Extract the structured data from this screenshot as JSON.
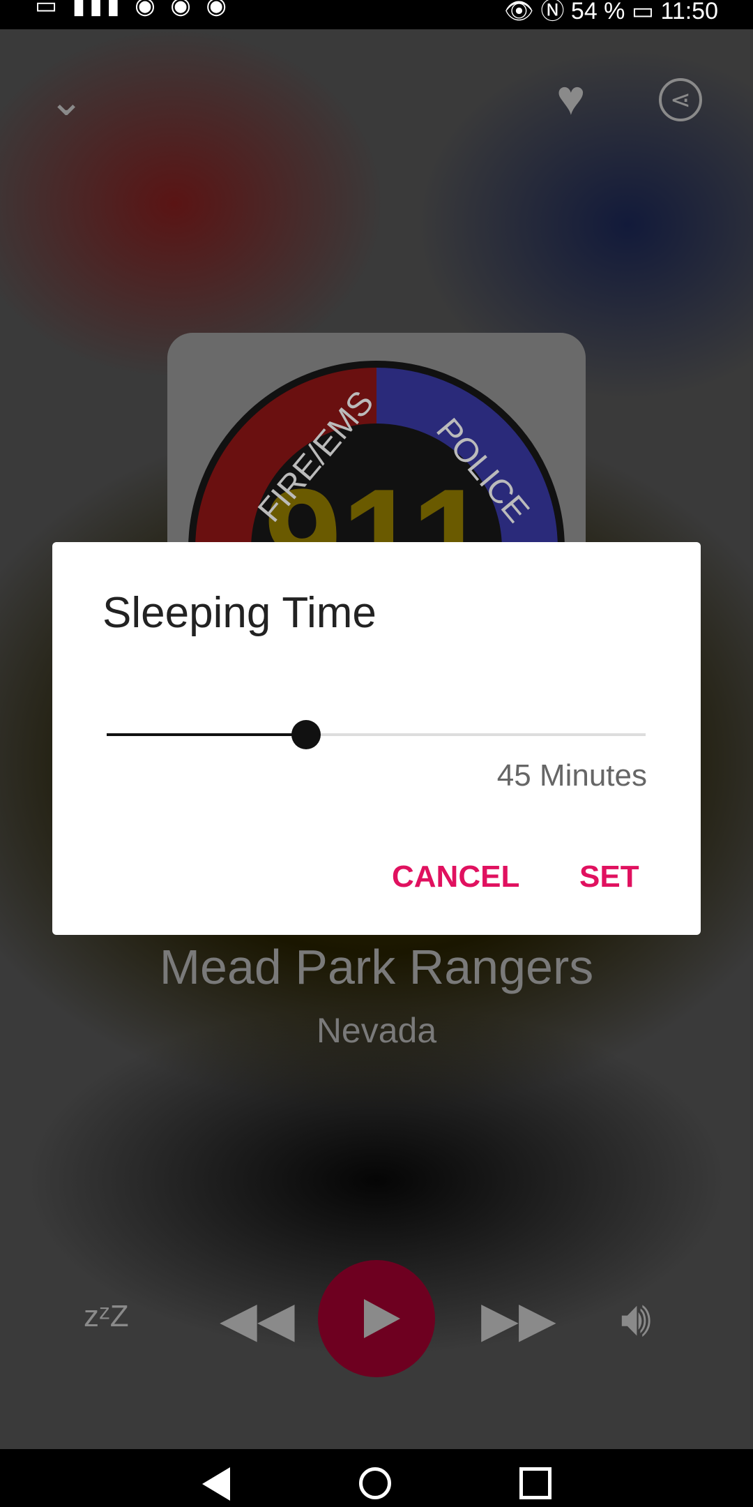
{
  "status_bar": {
    "left_icons": "VoWiFi signal wifi cast apps",
    "battery": "54 %",
    "time": "11:50"
  },
  "player": {
    "station_name_partial": "",
    "station_name_line2": "Mead Park Rangers",
    "region": "Nevada",
    "artwork": {
      "left_text": "FIRE/EMS",
      "right_text": "POLICE",
      "number": "911"
    },
    "accent_color": "#6e0020"
  },
  "dialog": {
    "title": "Sleeping Time",
    "slider_percent": 37,
    "value_label": "45 Minutes",
    "cancel_label": "CANCEL",
    "set_label": "SET",
    "button_color": "#e0115f"
  }
}
